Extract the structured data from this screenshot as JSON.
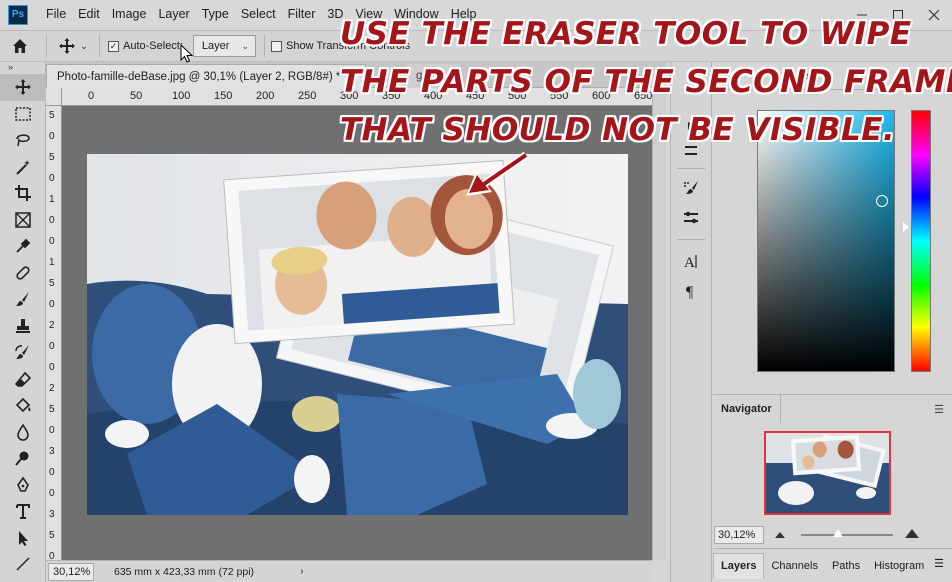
{
  "app": {
    "logo_text": "Ps"
  },
  "menu": [
    "File",
    "Edit",
    "Image",
    "Layer",
    "Type",
    "Select",
    "Filter",
    "3D",
    "View",
    "Window",
    "Help"
  ],
  "options_bar": {
    "auto_select_label": "Auto-Select:",
    "auto_select_checked": true,
    "layer_select_value": "Layer",
    "show_transform_label": "Show Transform Controls",
    "show_transform_checked": false
  },
  "document_tabs": {
    "active": "Photo-famille-deBase.jpg @ 30,1% (Layer 2, RGB/8#) *",
    "active_close": "×",
    "other": "ge@..."
  },
  "ruler": {
    "h_ticks": [
      "0",
      "50",
      "100",
      "150",
      "200",
      "250",
      "300",
      "350",
      "400",
      "450",
      "500",
      "550",
      "600",
      "650"
    ],
    "v_ticks": [
      "5",
      "0",
      "5",
      "0",
      "1",
      "0",
      "0",
      "1",
      "5",
      "0",
      "2",
      "0",
      "0",
      "2",
      "5",
      "0",
      "3",
      "0",
      "0",
      "3",
      "5",
      "0"
    ]
  },
  "status_bar": {
    "zoom": "30,12%",
    "doc_size": "635 mm x 423,33 mm (72 ppi)",
    "arrow": "›"
  },
  "color_panel": {
    "header": "ure"
  },
  "navigator": {
    "title": "Navigator",
    "zoom": "30,12%"
  },
  "layers_tabs": [
    "Layers",
    "Channels",
    "Paths",
    "Histogram"
  ],
  "annotation": {
    "lines": [
      "USE THE ERASER TOOL TO WIPE",
      "THE PARTS OF THE SECOND FRAME",
      "THAT SHOULD NOT BE VISIBLE."
    ],
    "color": "#a31518"
  },
  "colors": {
    "ui_bg": "#d6d6d6",
    "canvas_bg": "#707070",
    "sofa_blue": "#2d4f7a",
    "navigator_border": "#e0343f"
  }
}
